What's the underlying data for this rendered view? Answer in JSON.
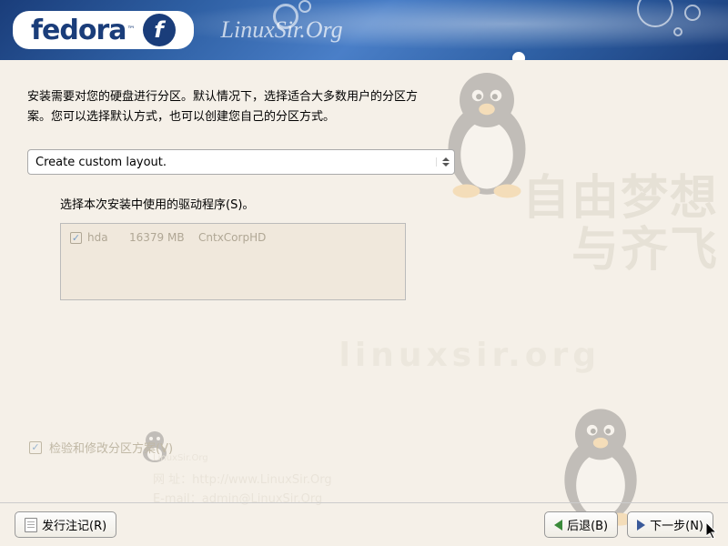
{
  "header": {
    "brand": "fedora",
    "tm": "™",
    "f_logo": "f",
    "linuxsir": "LinuxSir.Org"
  },
  "main": {
    "description": "安装需要对您的硬盘进行分区。默认情况下，选择适合大多数用户的分区方案。您可以选择默认方式，也可以创建您自己的分区方式。",
    "partition_scheme": "Create custom layout.",
    "drive_label": "选择本次安装中使用的驱动程序(S)。",
    "drives": [
      {
        "checked": true,
        "name": "hda",
        "size": "16379 MB",
        "model": "CntxCorpHD"
      }
    ],
    "review_label": "检验和修改分区方案(V)"
  },
  "watermark": {
    "big_text_line1": "自由梦想",
    "big_text_line2": "与齐飞",
    "url_text": "linuxsir.org",
    "site_label": "网  址：",
    "site_url": "http://www.LinuxSir.Org",
    "email_label": "E-mail：",
    "email": "admin@LinuxSir.Org",
    "small_logo": "LinuxSir.Org"
  },
  "footer": {
    "release_notes": "发行注记(R)",
    "back": "后退(B)",
    "next": "下一步(N)"
  }
}
